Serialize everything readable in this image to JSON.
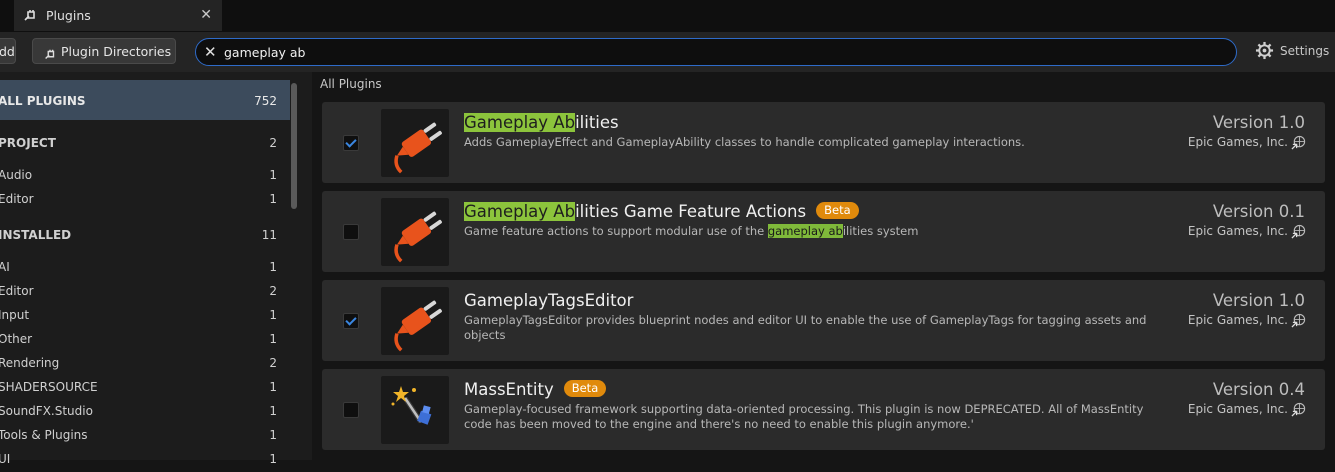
{
  "tab": {
    "title": "Plugins",
    "icon": "plug-icon",
    "close_glyph": "✕"
  },
  "toolbar": {
    "add_label": "dd",
    "dirs_label": "Plugin Directories",
    "search_value": "gameplay ab",
    "settings_label": "Settings"
  },
  "sidebar": {
    "all": {
      "label": "ALL PLUGINS",
      "count": "752"
    },
    "project": {
      "label": "PROJECT",
      "count": "2"
    },
    "project_items": [
      {
        "label": "Audio",
        "count": "1"
      },
      {
        "label": "Editor",
        "count": "1"
      }
    ],
    "installed": {
      "label": "INSTALLED",
      "count": "11"
    },
    "installed_items": [
      {
        "label": "AI",
        "count": "1"
      },
      {
        "label": "Editor",
        "count": "2"
      },
      {
        "label": "Input",
        "count": "1"
      },
      {
        "label": "Other",
        "count": "1"
      },
      {
        "label": "Rendering",
        "count": "2"
      },
      {
        "label": "SHADERSOURCE",
        "count": "1"
      },
      {
        "label": "SoundFX.Studio",
        "count": "1"
      },
      {
        "label": "Tools & Plugins",
        "count": "1"
      },
      {
        "label": "UI",
        "count": "1"
      }
    ]
  },
  "main": {
    "header": "All Plugins",
    "plugins": [
      {
        "name_hl": "Gameplay Ab",
        "name_rest": "ilities",
        "desc": "Adds GameplayEffect and GameplayAbility classes to handle complicated gameplay interactions.",
        "version": "Version 1.0",
        "author": "Epic Games, Inc.",
        "enabled": true,
        "beta": false
      },
      {
        "name_hl": "Gameplay Ab",
        "name_rest": "ilities Game Feature Actions",
        "desc_pre": "Game feature actions to support modular use of the ",
        "desc_hl": "gameplay ab",
        "desc_post": "ilities system",
        "version": "Version 0.1",
        "author": "Epic Games, Inc.",
        "enabled": false,
        "beta": true,
        "beta_label": "Beta"
      },
      {
        "name": "GameplayTagsEditor",
        "desc": "GameplayTagsEditor provides blueprint nodes and editor UI to enable the use of GameplayTags for tagging assets and objects",
        "version": "Version 1.0",
        "author": "Epic Games, Inc.",
        "enabled": true,
        "beta": false
      },
      {
        "name": "MassEntity",
        "desc": "Gameplay-focused framework supporting data-oriented processing. This plugin is now DEPRECATED. All of MassEntity code has been moved to the engine and there's no need to enable this plugin anymore.'",
        "version": "Version 0.4",
        "author": "Epic Games, Inc.",
        "enabled": false,
        "beta": true,
        "beta_label": "Beta"
      }
    ]
  },
  "colors": {
    "accent": "#2e6bc9",
    "highlight": "#8cc43c",
    "beta": "#e08a0c",
    "selected_row": "#3c4b5c"
  }
}
